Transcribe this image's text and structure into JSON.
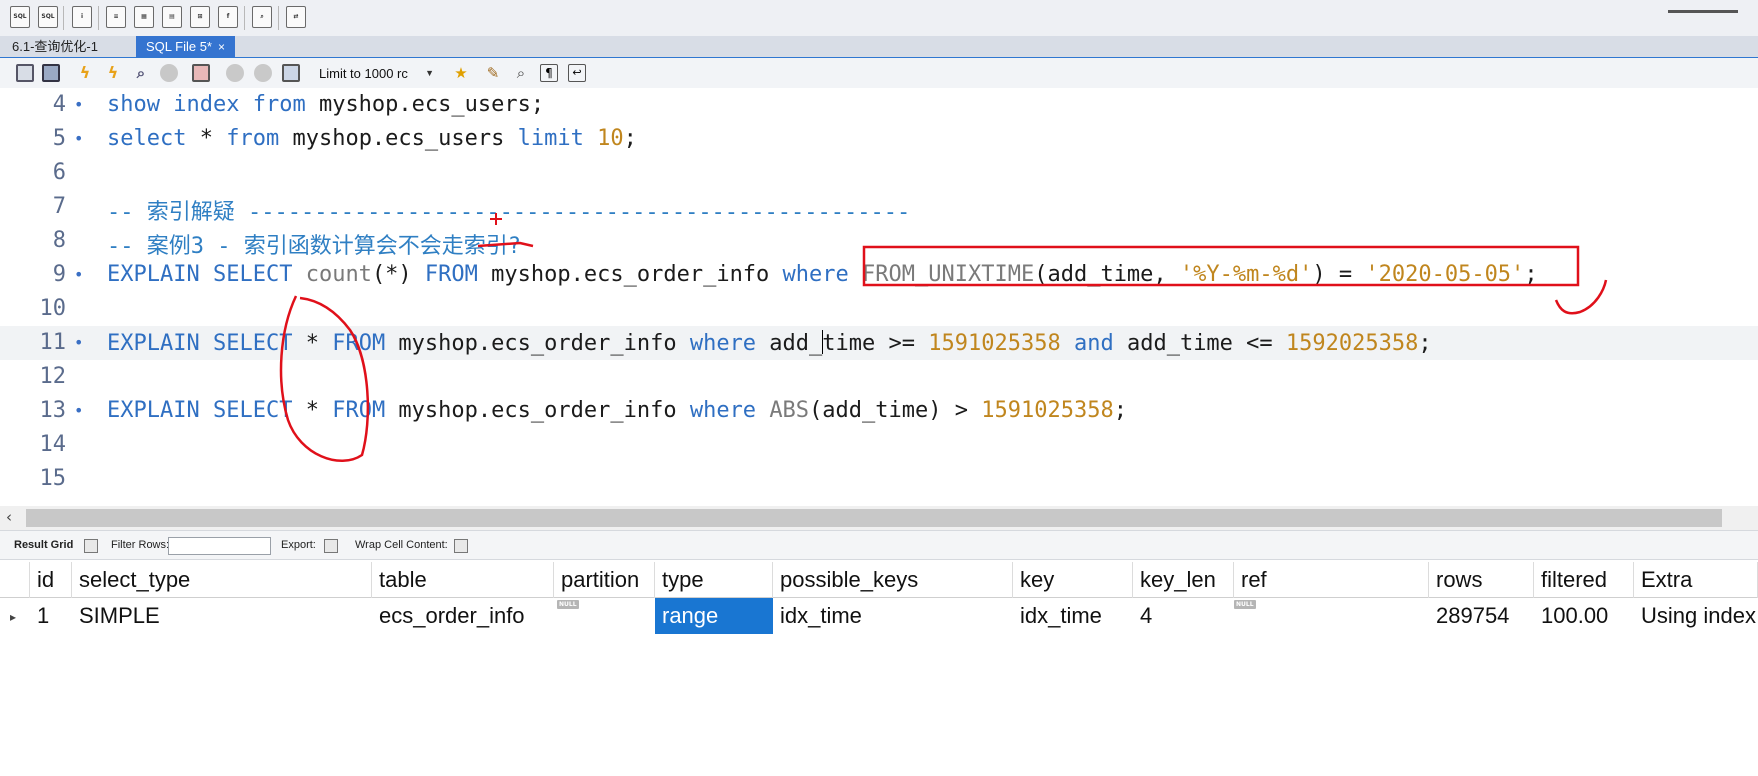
{
  "tabs": [
    {
      "label": "6.1-查询优化-1"
    },
    {
      "label": "SQL File 5*",
      "close": "×"
    }
  ],
  "editor_toolbar": {
    "limit_label": "Limit to 1000 rc",
    "icons": [
      "open-folder-icon",
      "save-icon",
      "execute-icon",
      "execute-current-icon",
      "explain-icon",
      "stop-icon",
      "toggle-error-icon",
      "commit-icon",
      "rollback-icon",
      "autocommit-icon",
      "bookmark-icon",
      "beautify-icon",
      "find-icon",
      "invisible-chars-icon",
      "wrap-icon"
    ]
  },
  "editor": {
    "lines": [
      {
        "num": "4",
        "bullet": "•"
      },
      {
        "num": "5",
        "bullet": "•"
      },
      {
        "num": "6",
        "bullet": ""
      },
      {
        "num": "7",
        "bullet": ""
      },
      {
        "num": "8",
        "bullet": ""
      },
      {
        "num": "9",
        "bullet": "•"
      },
      {
        "num": "10",
        "bullet": ""
      },
      {
        "num": "11",
        "bullet": "•"
      },
      {
        "num": "12",
        "bullet": ""
      },
      {
        "num": "13",
        "bullet": "•"
      },
      {
        "num": "14",
        "bullet": ""
      },
      {
        "num": "15",
        "bullet": ""
      }
    ],
    "code": {
      "l4": [
        "show",
        " ",
        "index",
        " ",
        "from",
        " myshop.ecs_users;"
      ],
      "l5": [
        "select",
        " * ",
        "from",
        " myshop.ecs_users ",
        "limit",
        " ",
        "10",
        ";"
      ],
      "l7": "-- 索引解疑 --------------------------------------------------",
      "l8": "-- 案例3 - 索引函数计算会不会走索引?",
      "l9": [
        "EXPLAIN",
        " ",
        "SELECT",
        " ",
        "count",
        "(*) ",
        "FROM",
        " myshop.ecs_order_info ",
        "where",
        " ",
        "FROM_UNIXTIME",
        "(add_time, ",
        "'%Y-%m-%d'",
        ") = ",
        "'2020-05-05'",
        ";"
      ],
      "l11": [
        "EXPLAIN",
        " ",
        "SELECT",
        " * ",
        "FROM",
        " myshop.ecs_order_info ",
        "where",
        " add_",
        "time >= ",
        "1591025358",
        " ",
        "and",
        " add_time <= ",
        "1592025358",
        ";"
      ],
      "l13": [
        "EXPLAIN",
        " ",
        "SELECT",
        " * ",
        "FROM",
        " myshop.ecs_order_info ",
        "where",
        " ",
        "ABS",
        "(add_time) > ",
        "1591025358",
        ";"
      ]
    }
  },
  "result_toolbar": {
    "result_grid": "Result Grid",
    "filter_rows": "Filter Rows:",
    "export": "Export:",
    "wrap": "Wrap Cell Content:"
  },
  "grid": {
    "columns": [
      "id",
      "select_type",
      "table",
      "partition",
      "type",
      "possible_keys",
      "key",
      "key_len",
      "ref",
      "rows",
      "filtered",
      "Extra"
    ],
    "rows": [
      {
        "id": "1",
        "select_type": "SIMPLE",
        "table": "ecs_order_info",
        "partition": "NULL",
        "type": "range",
        "possible_keys": "idx_time",
        "key": "idx_time",
        "key_len": "4",
        "ref": "NULL",
        "rows": "289754",
        "filtered": "100.00",
        "Extra": "Using index"
      }
    ]
  },
  "colors": {
    "keyword": "#2f6fc2",
    "number": "#c0861e",
    "comment": "#2f7fc3",
    "tab_active": "#3574d0",
    "highlight": "#1976d2",
    "annotation": "#e0101a"
  }
}
